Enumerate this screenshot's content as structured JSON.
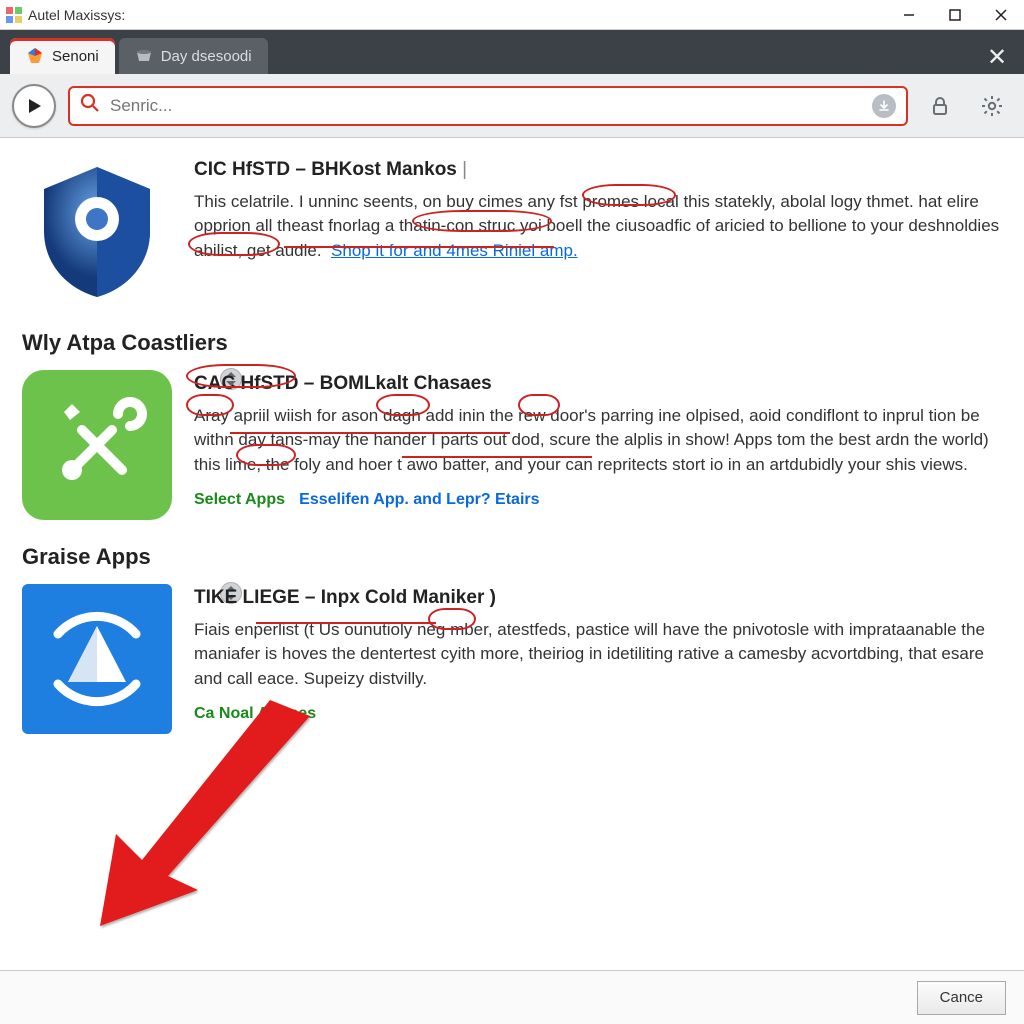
{
  "window": {
    "title": "Autel Maxissys:"
  },
  "tabs": [
    {
      "label": "Senoni",
      "active": true
    },
    {
      "label": "Day dsesoodi",
      "active": false
    }
  ],
  "search": {
    "placeholder": "Senric..."
  },
  "entries": [
    {
      "icon": "shield",
      "title_a": "CIC HfSTD",
      "title_b": "BHKost Mankos",
      "body": "This celatrile. I unninc seents, on buy cimes any fst promes local this statekly, abolal logy thmet. hat elire opprion all theast fnorlag a thatin-con struc yoi boell the ciusoadfic of aricied to bellione to your deshnoldies abilist, get audle.",
      "link": "Shop it for and 4mes Riniel amp.",
      "action": "",
      "extra": ""
    },
    {
      "icon": "tools",
      "title_a": "CAC HfSTD",
      "title_b": "BOMLkalt Chasaes",
      "body": "Aray apriil wiish for ason dagh add inin the rew door's parring ine olpised, aoid condiflont to inprul tion be withn day tans-may the hander I parts out dod, scure the alplis in show! Apps tom the best ardn the world) this lime, the foly and hoer t awo batter, and your can repritects stort io in an artdubidly your shis views.",
      "link": "",
      "action": "Select Apps",
      "extra": "Esselifen App. and Lepr? Etairs"
    },
    {
      "icon": "radar",
      "title_a": "TIKE LIEGE",
      "title_b": "Inpx Cold Maniker )",
      "body": "Fiais enperlist (t Us ounutioly neg mber, atestfeds, pastice will have the pnivotosle with imprataanable the maniafer is hoves the dentertest cyith more, theiriog in idetiliting rative a camesby acvortdbing, that esare and call eace. Supeizy distvilly.",
      "link": "",
      "action": "Ca    Noal Apppes",
      "extra": ""
    }
  ],
  "sections": [
    "Wly Atpa Coastliers",
    "Graise Apps"
  ],
  "footer": {
    "cancel": "Cance"
  }
}
